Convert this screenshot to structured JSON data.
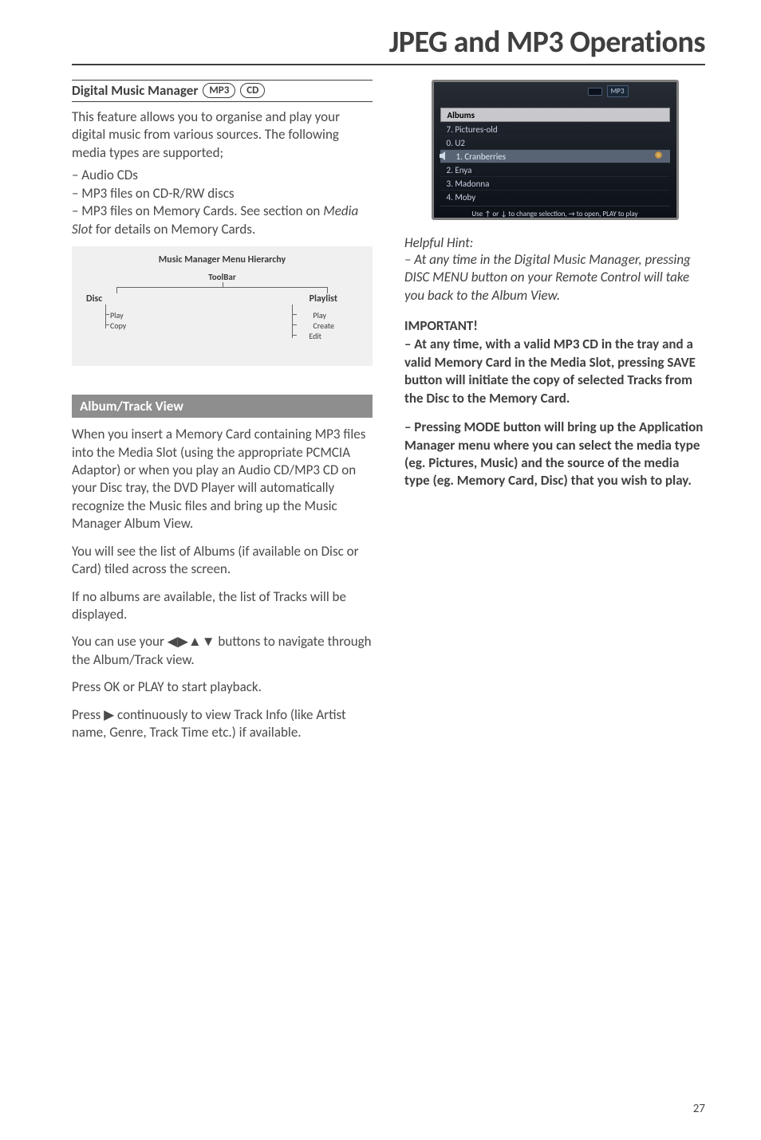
{
  "page": {
    "title": "JPEG and MP3 Operations",
    "number": "27"
  },
  "left": {
    "heading": "Digital Music Manager",
    "badges": {
      "mp3": "MP3",
      "cd": "CD"
    },
    "intro": "This feature allows you to organise and play your digital music from various sources. The following media types are supported;",
    "list": {
      "a": "– Audio CDs",
      "b": "– MP3 files on CD-R/RW discs",
      "c_pre": "– MP3 files on Memory Cards. See section on ",
      "c_em": "Media Slot",
      "c_post": " for details on Memory Cards."
    },
    "hierarchy": {
      "title": "Music Manager Menu Hierarchy",
      "toolbar": "ToolBar",
      "disc": "Disc",
      "playlist": "Playlist",
      "disc_items": {
        "play": "Play",
        "copy": "Copy"
      },
      "playlist_items": {
        "play": "Play",
        "create": "Create",
        "edit": "Edit"
      }
    },
    "subheading": "Album/Track View",
    "p1": "When you insert a Memory Card containing MP3 files into the Media Slot (using the appropriate PCMCIA Adaptor) or when you play an Audio CD/MP3 CD on your Disc tray, the DVD Player will automatically recognize the Music files and bring up the Music Manager Album View.",
    "p2": "You will see the list of Albums (if available on Disc or Card) tiled across the screen.",
    "p3": "If no albums are available, the list of Tracks will be displayed.",
    "p4_pre": "You can use your ",
    "p4_arrows": "◀▶▲▼",
    "p4_post": " buttons to navigate through the Album/Track view.",
    "p5": "Press OK or PLAY to start playback.",
    "p6_pre": "Press ",
    "p6_arrow": "▶",
    "p6_post": " continuously to view Track Info (like Artist name, Genre, Track Time etc.) if available."
  },
  "screenshot": {
    "mp3_tag": "MP3",
    "header": "Albums",
    "rows": {
      "r0": "7. Pictures-old",
      "r1": "0. U2",
      "r2": "1. Cranberries",
      "r3": "2. Enya",
      "r4": "3. Madonna",
      "r5": "4. Moby"
    },
    "hint": "Use ↑ or ↓ to change selection, → to open, PLAY to play"
  },
  "right": {
    "hint_label": "Helpful Hint:",
    "hint_body": "–   At any time in the Digital Music Manager, pressing DISC MENU button on your Remote Control will take you back to the Album View.",
    "important": "IMPORTANT!",
    "bold1": "–  At any time, with a valid MP3 CD in the tray and a valid Memory Card in the Media Slot, pressing SAVE button will initiate the copy of selected Tracks from the Disc to the Memory Card.",
    "bold2": "–  Pressing MODE button will bring up the Application Manager menu where you can select the media type (eg. Pictures, Music) and the source of the media type (eg. Memory Card, Disc) that you wish to play."
  }
}
